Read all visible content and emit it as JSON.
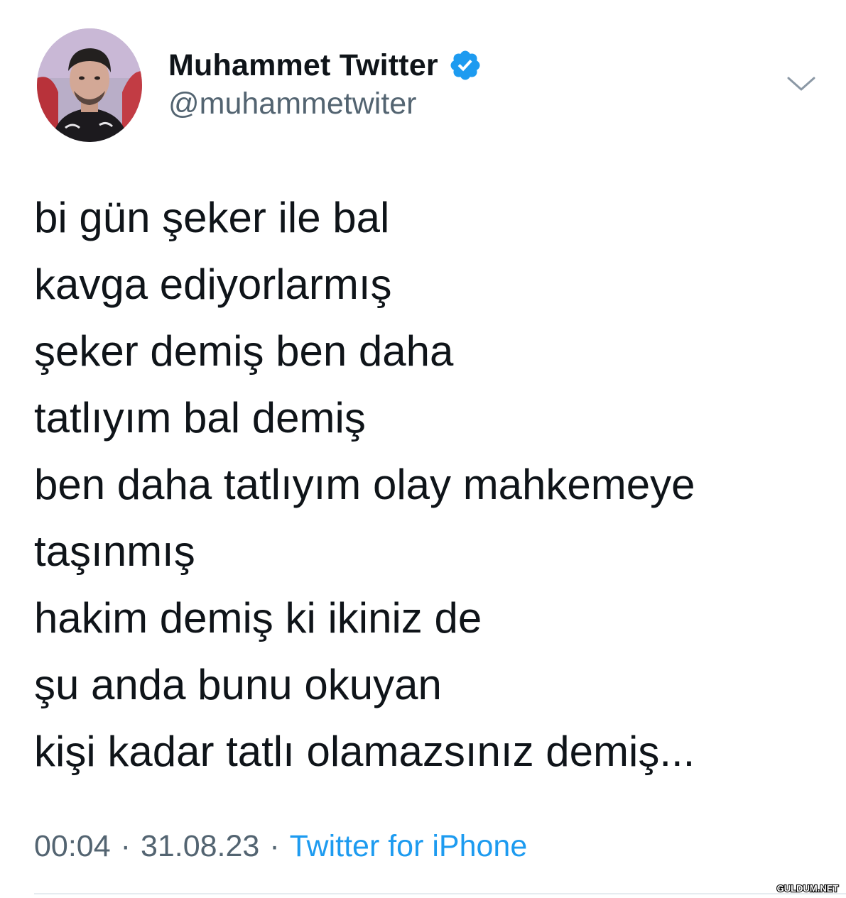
{
  "tweet": {
    "author": {
      "display_name": "Muhammet Twitter",
      "handle": "@muhammetwiter",
      "verified": true
    },
    "lines": [
      "bi gün şeker ile bal",
      "kavga ediyorlarmış",
      "şeker demiş ben daha",
      "tatlıyım bal demiş",
      "ben daha tatlıyım olay mahkemeye",
      "taşınmış",
      "hakim demiş ki ikiniz de",
      "şu anda bunu okuyan",
      "kişi kadar tatlı olamazsınız demiş..."
    ],
    "meta": {
      "time": "00:04",
      "separator": "·",
      "date": "31.08.23",
      "source": "Twitter for iPhone"
    }
  },
  "icons": {
    "verified": "verified-badge-icon",
    "caret": "chevron-down-icon"
  },
  "watermark": "GULDUM.NET",
  "colors": {
    "text_primary": "#0f1419",
    "text_secondary": "#536471",
    "accent": "#1d9bf0",
    "divider": "#e6ecf0"
  }
}
